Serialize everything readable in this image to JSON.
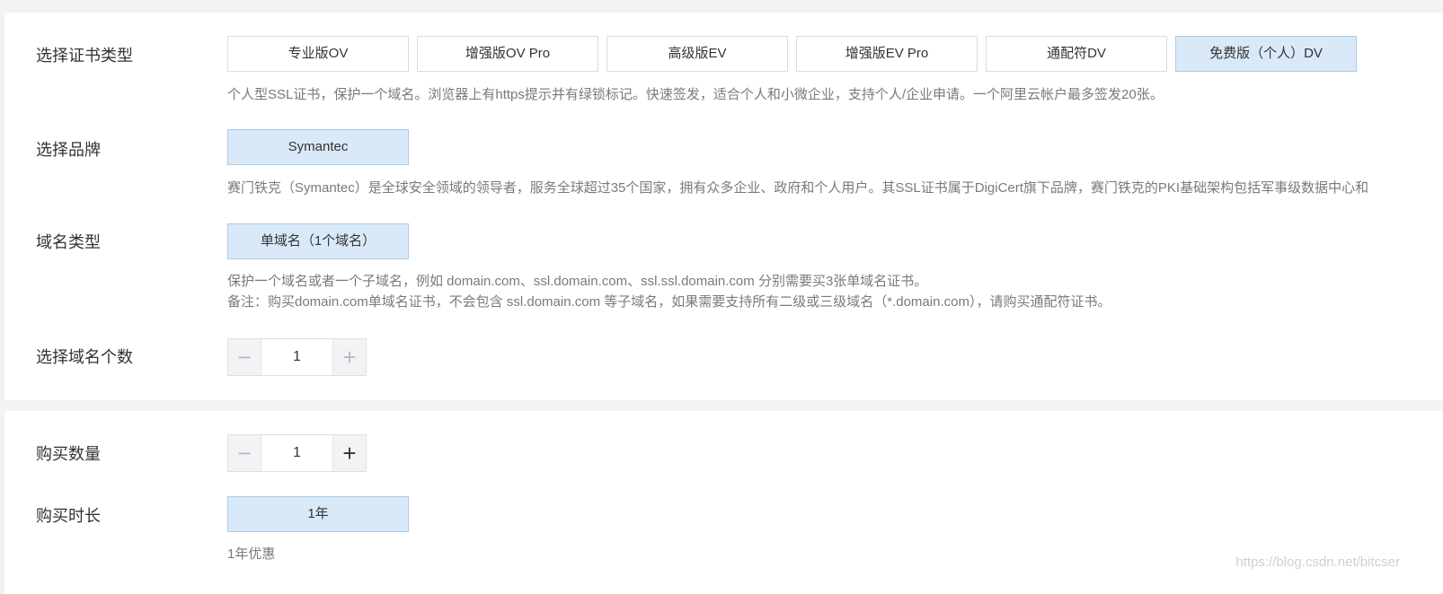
{
  "cert_type": {
    "label": "选择证书类型",
    "options": [
      "专业版OV",
      "增强版OV Pro",
      "高级版EV",
      "增强版EV Pro",
      "通配符DV",
      "免费版（个人）DV"
    ],
    "selected_index": 5,
    "description": "个人型SSL证书，保护一个域名。浏览器上有https提示并有绿锁标记。快速签发，适合个人和小微企业，支持个人/企业申请。一个阿里云帐户最多签发20张。"
  },
  "brand": {
    "label": "选择品牌",
    "options": [
      "Symantec"
    ],
    "description": "赛门铁克（Symantec）是全球安全领域的领导者，服务全球超过35个国家，拥有众多企业、政府和个人用户。其SSL证书属于DigiCert旗下品牌，赛门铁克的PKI基础架构包括军事级数据中心和"
  },
  "domain_type": {
    "label": "域名类型",
    "options": [
      "单域名（1个域名）"
    ],
    "description_1": "保护一个域名或者一个子域名，例如 domain.com、ssl.domain.com、ssl.ssl.domain.com 分别需要买3张单域名证书。",
    "description_2": "备注：购买domain.com单域名证书，不会包含 ssl.domain.com 等子域名，如果需要支持所有二级或三级域名（*.domain.com），请购买通配符证书。"
  },
  "domain_count": {
    "label": "选择域名个数",
    "minus": "−",
    "plus": "+",
    "value": "1"
  },
  "quantity": {
    "label": "购买数量",
    "minus": "−",
    "plus": "+",
    "value": "1"
  },
  "duration": {
    "label": "购买时长",
    "options": [
      "1年"
    ],
    "description": "1年优惠"
  },
  "watermark": "https://blog.csdn.net/bitcser"
}
